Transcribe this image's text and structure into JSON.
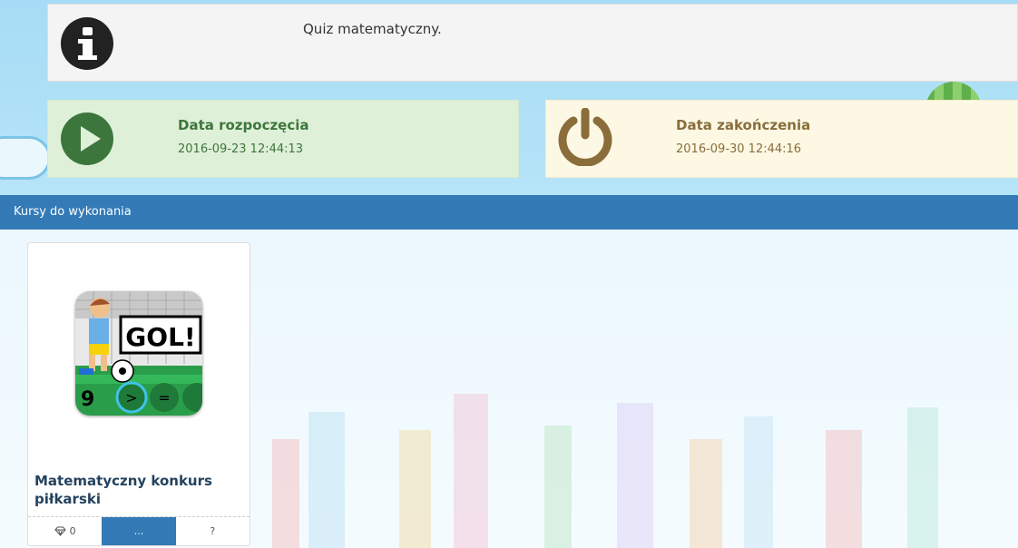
{
  "info": {
    "title": "Quiz matematyczny."
  },
  "start": {
    "title": "Data rozpoczęcia",
    "date": "2016-09-23 12:44:13"
  },
  "end": {
    "title": "Data zakończenia",
    "date": "2016-09-30 12:44:16"
  },
  "courses_bar": {
    "label": "Kursy do wykonania"
  },
  "course": {
    "title": "Matematyczny konkurs piłkarski",
    "thumb_text": "GOL!",
    "thumb_number": "9",
    "thumb_ops": [
      ">",
      "="
    ],
    "points": "0",
    "action_label": "...",
    "help_label": "?"
  },
  "colors": {
    "accent": "#337ab7",
    "success": "#3c763d",
    "warning": "#8a6d3b"
  },
  "icons": {
    "info": "info-icon",
    "start": "play-icon",
    "end": "power-icon",
    "points": "diamond-icon"
  }
}
